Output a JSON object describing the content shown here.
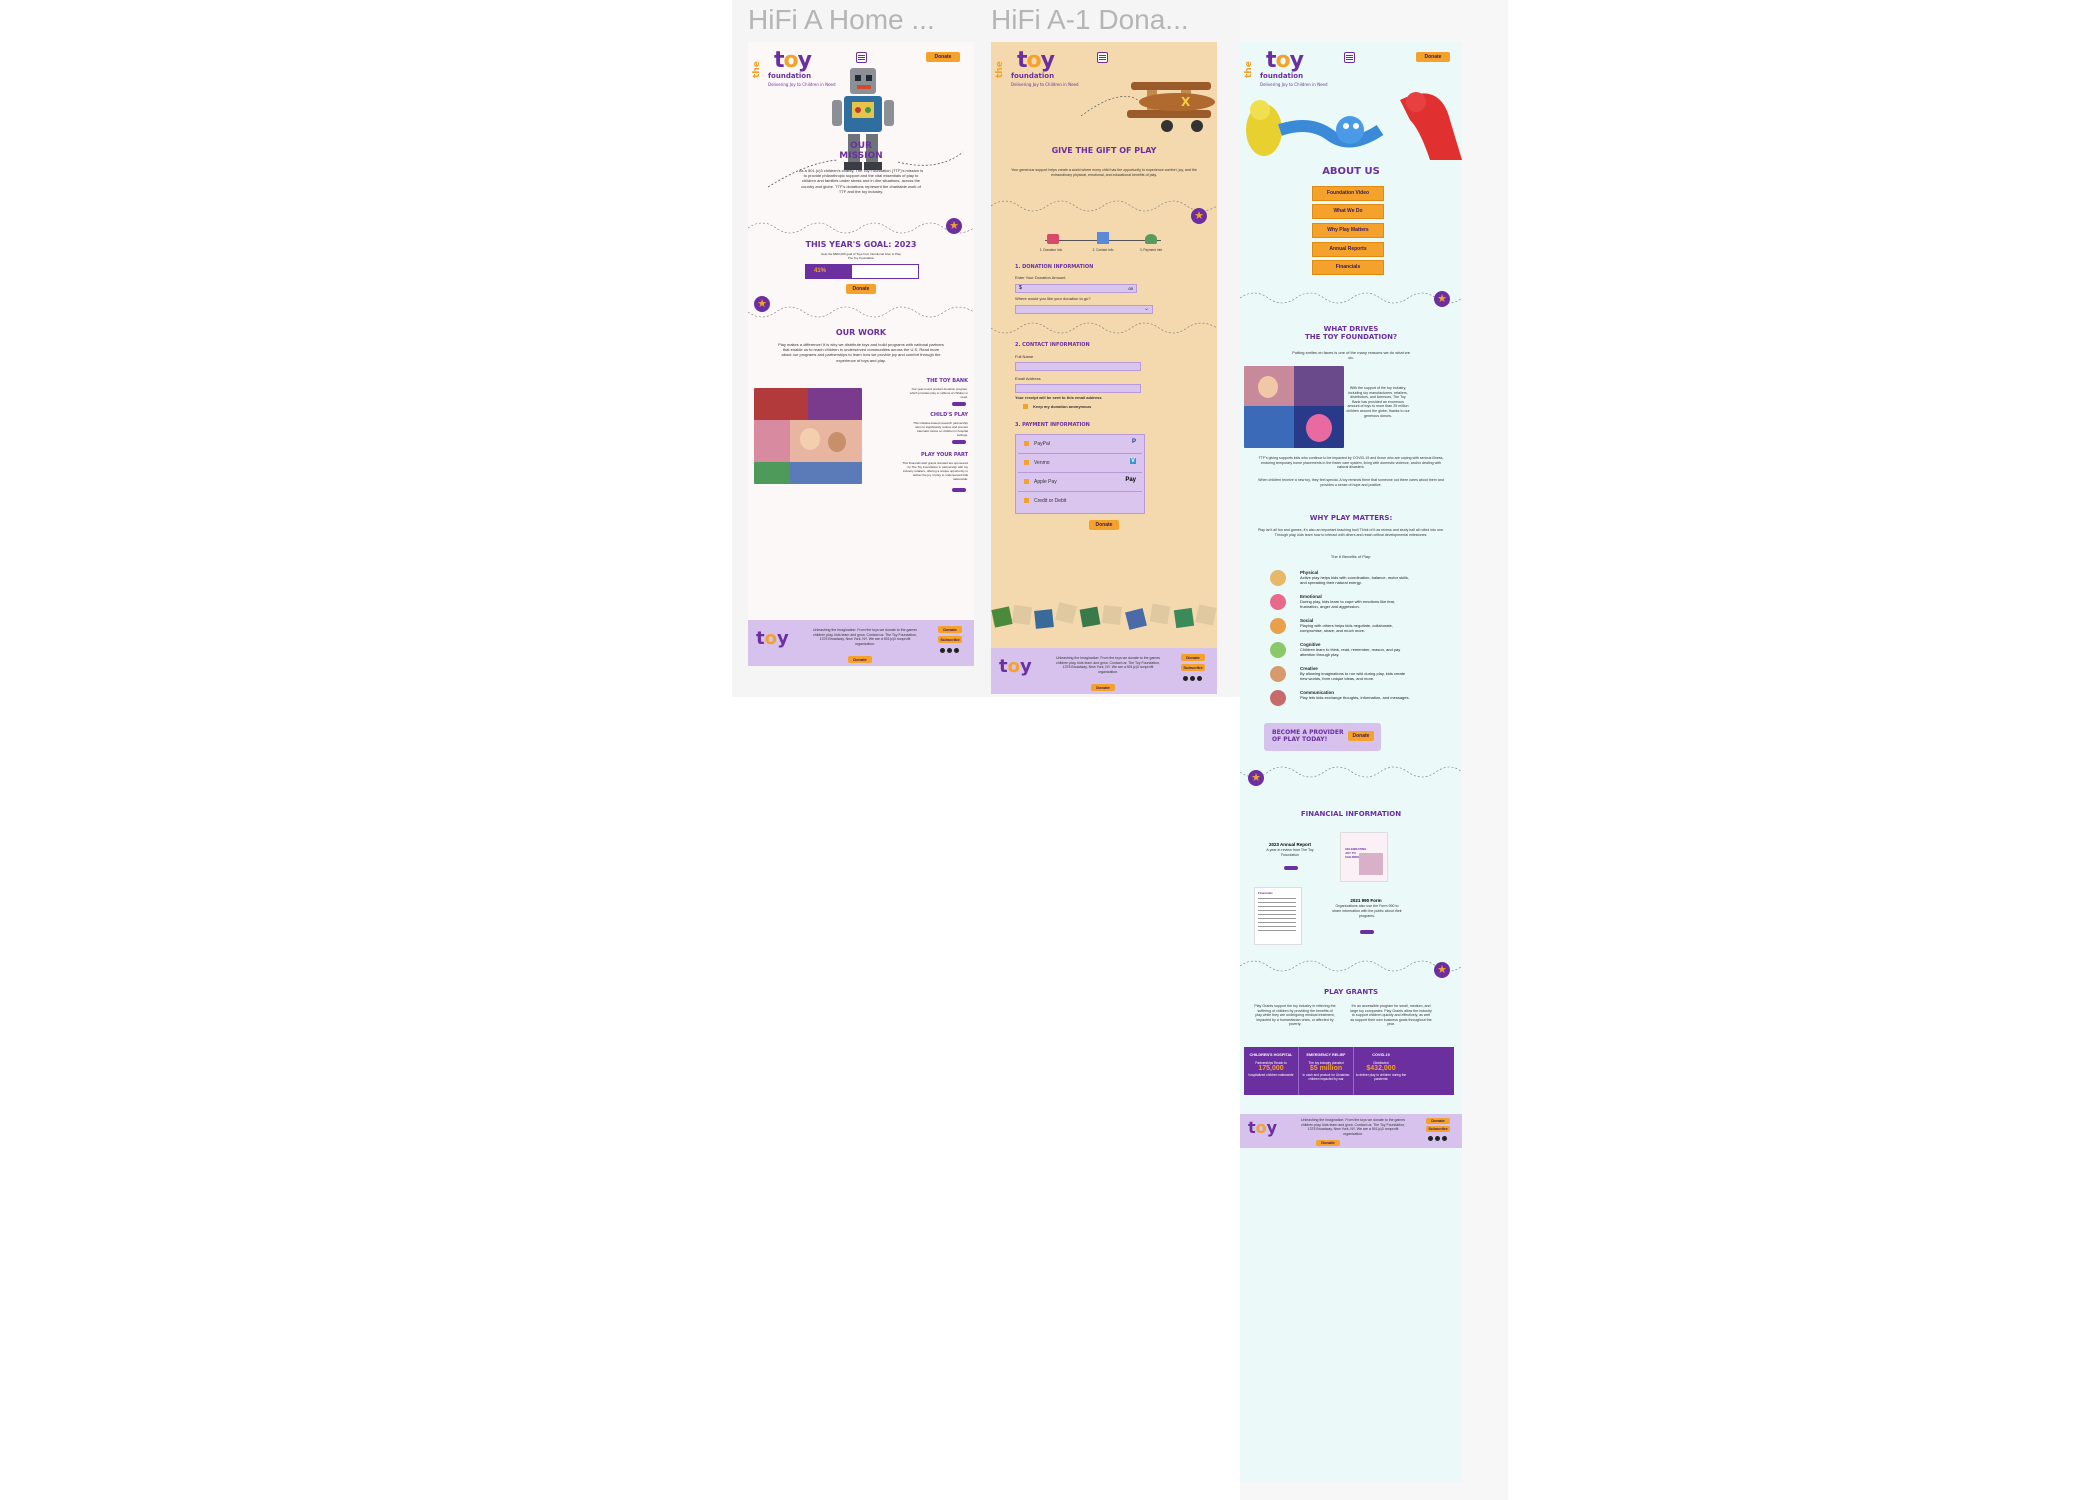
{
  "frames": {
    "home_title": "HiFi A Home ...",
    "donate_title": "HiFi A-1 Dona..."
  },
  "brand": {
    "the": "the",
    "toy_t": "t",
    "toy_o": "o",
    "toy_y": "y",
    "foundation": "foundation",
    "tagline": "Delivering Joy to Children in Need",
    "donate_label": "Donate",
    "colors": {
      "purple": "#6b2fa0",
      "orange": "#f4a22c",
      "lavender": "#d6c2ec"
    }
  },
  "home": {
    "mission_title_1": "OUR",
    "mission_title_2": "MISSION",
    "mission_text": "As a 501 (c)3 children's charity, The Toy Foundation (TTF)'s mission is to provide philanthropic support and the vital essentials of play to children and families under stress and in dire situations, across the country and globe. TTF's donations represent the charitable work of TTF and the toy industry.",
    "goal_title": "THIS YEAR'S GOAL: 2023",
    "goal_subtext": "Help the $500,000 goal of Toys from Intentional Give to Play The Toy Foundation",
    "progress_label": "41%",
    "progress_value": 41,
    "work_title": "OUR WORK",
    "work_text": "Play makes a difference! It is why we distribute toys and build programs with national partners that enable us to reach children in underserved communities across the U.S. Read more about our programs and partnerships to learn how we provide joy and comfort through the experience of toys and play.",
    "programs": [
      {
        "title": "THE TOY BANK",
        "text": "Our year-round product donation program, which provides play to millions of children in need."
      },
      {
        "title": "CHILD'S PLAY",
        "text": "This initiative-based research partnership aims to significantly reduce and prevent traumatic stress on children in hospital settings."
      },
      {
        "title": "PLAY YOUR PART",
        "text": "This financial relief grants donated are sponsored by The Toy Foundation in partnership with toy industry retailers, offering a unique opportunity to deliver the joy of play to underserved kids nationwide."
      }
    ]
  },
  "donate": {
    "title": "GIVE THE GIFT OF PLAY",
    "intro": "Your generous support helps create a world where every child has the opportunity to experience comfort, joy, and the extraordinary physical, emotional, and educational benefits of play.",
    "steps": [
      "1. Donation Info",
      "2. Contact Info",
      "3. Payment Info"
    ],
    "sec1": "1. DONATION INFORMATION",
    "amount_label": "Enter Your Donation Amount",
    "amount_prefix": "$",
    "amount_suffix": ".00",
    "where_label": "Where would you like your donation to go?",
    "sec2": "2. CONTACT INFORMATION",
    "name_label": "Full Name",
    "email_label": "Email Address",
    "receipt_note": "Your receipt will be sent to this email address",
    "anon_label": "Keep my donation anonymous",
    "sec3": "3. PAYMENT INFORMATION",
    "pay_options": [
      {
        "label": "PayPal",
        "mark": "P"
      },
      {
        "label": "Venmo",
        "mark": "V"
      },
      {
        "label": "Apple Pay",
        "mark": "Pay"
      },
      {
        "label": "Credit or Debit",
        "mark": ""
      }
    ]
  },
  "about": {
    "title": "ABOUT US",
    "links": [
      "Foundation Video",
      "What We Do",
      "Why Play Matters",
      "Annual Reports",
      "Financials"
    ],
    "drives_title_1": "WHAT DRIVES",
    "drives_title_2": "THE TOY FOUNDATION?",
    "drives_sub": "Putting smiles on faces is one of the many reasons we do what we do.",
    "drives_side": "With the support of the toy industry, including toy manufacturers, retailers, distributors, and licensors, The Toy Bank has provided an enormous amount of toys to more than 25 million children around the globe, thanks to our generous donors.",
    "drives_p1": "TTF's giving supports kids who continue to be impacted by COVID-19 and those who are coping with serious illness, enduring temporary home placements in the foster care system, living with domestic violence, and/or dealing with natural disasters.",
    "drives_p2": "When children receive a new toy, they feel special. A toy reminds them that someone out there cares about them and provides a sense of hope and positive.",
    "why_title": "WHY PLAY MATTERS:",
    "why_text": "Play isn't all fun and games, it's also an important teaching tool! Think of it as recess and study hall all rolled into one. Through play, kids learn how to interact with others and reach critical developmental milestones.",
    "benefits_title": "The 6 Benefits of Play:",
    "benefits": [
      {
        "name": "Physical",
        "text": "Active play helps kids with coordination, balance, motor skills, and spreading their natural energy."
      },
      {
        "name": "Emotional",
        "text": "During play, kids learn to cope with emotions like fear, frustration, anger and aggression."
      },
      {
        "name": "Social",
        "text": "Playing with others helps kids negotiate, collaborate, compromise, share, and much more."
      },
      {
        "name": "Cognitive",
        "text": "Children learn to think, read, remember, reason, and pay attention through play."
      },
      {
        "name": "Creative",
        "text": "By allowing imaginations to run wild during play, kids create new worlds, form unique ideas, and more."
      },
      {
        "name": "Communication",
        "text": "Play lets kids exchange thoughts, information, and messages."
      }
    ],
    "provider_line1": "BECOME A PROVIDER",
    "provider_line2": "OF PLAY TODAY!",
    "fin_title": "FINANCIAL INFORMATION",
    "report_title": "2023 Annual Report",
    "report_sub": "A year in review from The Toy Foundation",
    "report_thumb": "CELEBRATING JOY TO CHILDREN",
    "form_title": "2021 990 Form",
    "form_sub": "Organizations also use the Form 990 to share information with the public about their programs.",
    "form_thumb": "Financials",
    "grants_title": "PLAY GRANTS",
    "grants_p1": "Play Grants support the toy industry in relieving the suffering of children by providing the benefits of play while they are undergoing medical treatment, impacted by a humanitarian crisis, or affected by poverty.",
    "grants_p2": "It's an accessible program for small, medium, and large toy companies. Play Grants allow the industry to support children quickly and effectively, as well as support their own business goals throughout the year.",
    "grant_cols": [
      {
        "head": "CHILDREN'S HOSPITAL",
        "sub": "Partnerships Reach to",
        "num": "175,000",
        "foot": "hospitalized children nationwide"
      },
      {
        "head": "EMERGENCY RELIEF",
        "sub": "The toy industry donated",
        "num": "$5 million",
        "foot": "in cash and product for Ukrainian children impacted by war"
      },
      {
        "head": "COVID-19",
        "sub": "Distributed",
        "num": "$432,000",
        "foot": "to deliver play to children during the pandemic"
      }
    ]
  },
  "footer": {
    "text": "Unleashing the Imagination: From the toys we donate to the games children play, kids learn and grow. Contact us: The Toy Foundation, 1375 Broadway, New York, NY. We are a 501(c)3 nonprofit organization.",
    "links": [
      "Donate",
      "Subscribe"
    ],
    "bottom_btn": "Donate"
  }
}
